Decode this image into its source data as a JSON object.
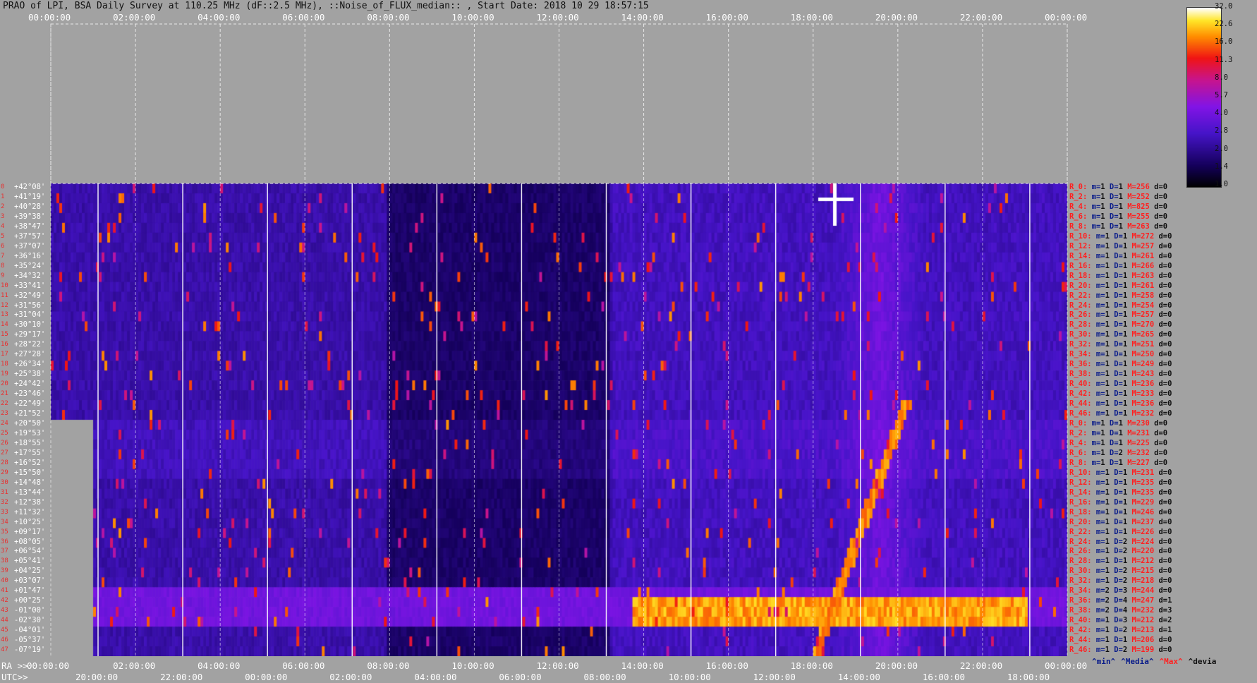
{
  "title": "PRAO of LPI, BSA Daily Survey at 110.25 MHz (dF::2.5 MHz), ::Noise_of_FLUX_median:: , Start Date: 2018 10 29 18:57:15",
  "top_axis": [
    "00:00:00",
    "02:00:00",
    "04:00:00",
    "06:00:00",
    "08:00:00",
    "10:00:00",
    "12:00:00",
    "14:00:00",
    "16:00:00",
    "18:00:00",
    "20:00:00",
    "22:00:00",
    "00:00:00"
  ],
  "ra_axis": {
    "prefix": "RA >>",
    "labels": [
      "00:00:00",
      "02:00:00",
      "04:00:00",
      "06:00:00",
      "08:00:00",
      "10:00:00",
      "12:00:00",
      "14:00:00",
      "16:00:00",
      "18:00:00",
      "20:00:00",
      "22:00:00",
      "00:00:00"
    ]
  },
  "utc_axis": {
    "prefix": "UTC>>",
    "labels": [
      "20:00:00",
      "22:00:00",
      "00:00:00",
      "02:00:00",
      "04:00:00",
      "06:00:00",
      "08:00:00",
      "10:00:00",
      "12:00:00",
      "14:00:00",
      "16:00:00",
      "18:00:00"
    ]
  },
  "colorbar": {
    "labels": [
      "32.0",
      "22.6",
      "16.0",
      "11.3",
      "8.0",
      "5.7",
      "4.0",
      "2.8",
      "2.0",
      "1.4",
      "1.0"
    ]
  },
  "declinations": [
    "+42°08'",
    "+41°19'",
    "+40°28'",
    "+39°38'",
    "+38°47'",
    "+37°57'",
    "+37°07'",
    "+36°16'",
    "+35°24'",
    "+34°32'",
    "+33°41'",
    "+32°49'",
    "+31°56'",
    "+31°04'",
    "+30°10'",
    "+29°17'",
    "+28°22'",
    "+27°28'",
    "+26°34'",
    "+25°38'",
    "+24°42'",
    "+23°46'",
    "+22°49'",
    "+21°52'",
    "+20°50'",
    "+19°53'",
    "+18°55'",
    "+17°55'",
    "+16°52'",
    "+15°50'",
    "+14°48'",
    "+13°44'",
    "+12°38'",
    "+11°32'",
    "+10°25'",
    "+09°17'",
    "+08°05'",
    "+06°54'",
    "+05°41'",
    "+04°25'",
    "+03°07'",
    "+01°47'",
    "+00°25'",
    "-01°00'",
    "-02°30'",
    "-04°01'",
    "-05°37'",
    "-07°19'"
  ],
  "row_numbers": [
    "0",
    "1",
    "2",
    "3",
    "4",
    "5",
    "6",
    "7",
    "8",
    "9",
    "10",
    "11",
    "12",
    "13",
    "14",
    "15",
    "16",
    "17",
    "18",
    "19",
    "20",
    "21",
    "22",
    "23",
    "24",
    "25",
    "26",
    "27",
    "28",
    "29",
    "30",
    "31",
    "32",
    "33",
    "34",
    "35",
    "36",
    "37",
    "38",
    "39",
    "40",
    "41",
    "42",
    "43",
    "44",
    "45",
    "46",
    "47"
  ],
  "stats": [
    {
      "r": "R_0:",
      "m": "1",
      "d": "1",
      "M": "256",
      "dv": "0"
    },
    {
      "r": "R_2:",
      "m": "1",
      "d": "1",
      "M": "252",
      "dv": "0"
    },
    {
      "r": "R_4:",
      "m": "1",
      "d": "1",
      "M": "825",
      "dv": "0"
    },
    {
      "r": "R_6:",
      "m": "1",
      "d": "1",
      "M": "255",
      "dv": "0"
    },
    {
      "r": "R_8:",
      "m": "1",
      "d": "1",
      "M": "263",
      "dv": "0"
    },
    {
      "r": "R_10:",
      "m": "1",
      "d": "1",
      "M": "272",
      "dv": "0"
    },
    {
      "r": "R_12:",
      "m": "1",
      "d": "1",
      "M": "257",
      "dv": "0"
    },
    {
      "r": "R_14:",
      "m": "1",
      "d": "1",
      "M": "261",
      "dv": "0"
    },
    {
      "r": "R_16:",
      "m": "1",
      "d": "1",
      "M": "266",
      "dv": "0"
    },
    {
      "r": "R_18:",
      "m": "1",
      "d": "1",
      "M": "263",
      "dv": "0"
    },
    {
      "r": "R_20:",
      "m": "1",
      "d": "1",
      "M": "261",
      "dv": "0"
    },
    {
      "r": "R_22:",
      "m": "1",
      "d": "1",
      "M": "258",
      "dv": "0"
    },
    {
      "r": "R_24:",
      "m": "1",
      "d": "1",
      "M": "254",
      "dv": "0"
    },
    {
      "r": "R_26:",
      "m": "1",
      "d": "1",
      "M": "257",
      "dv": "0"
    },
    {
      "r": "R_28:",
      "m": "1",
      "d": "1",
      "M": "270",
      "dv": "0"
    },
    {
      "r": "R_30:",
      "m": "1",
      "d": "1",
      "M": "265",
      "dv": "0"
    },
    {
      "r": "R_32:",
      "m": "1",
      "d": "1",
      "M": "251",
      "dv": "0"
    },
    {
      "r": "R_34:",
      "m": "1",
      "d": "1",
      "M": "250",
      "dv": "0"
    },
    {
      "r": "R_36:",
      "m": "1",
      "d": "1",
      "M": "249",
      "dv": "0"
    },
    {
      "r": "R_38:",
      "m": "1",
      "d": "1",
      "M": "243",
      "dv": "0"
    },
    {
      "r": "R_40:",
      "m": "1",
      "d": "1",
      "M": "236",
      "dv": "0"
    },
    {
      "r": "R_42:",
      "m": "1",
      "d": "1",
      "M": "233",
      "dv": "0"
    },
    {
      "r": "R_44:",
      "m": "1",
      "d": "1",
      "M": "236",
      "dv": "0"
    },
    {
      "r": "R_46:",
      "m": "1",
      "d": "1",
      "M": "232",
      "dv": "0"
    },
    {
      "r": "R_0:",
      "m": "1",
      "d": "1",
      "M": "230",
      "dv": "0"
    },
    {
      "r": "R_2:",
      "m": "1",
      "d": "1",
      "M": "231",
      "dv": "0"
    },
    {
      "r": "R_4:",
      "m": "1",
      "d": "1",
      "M": "225",
      "dv": "0"
    },
    {
      "r": "R_6:",
      "m": "1",
      "d": "2",
      "M": "232",
      "dv": "0"
    },
    {
      "r": "R_8:",
      "m": "1",
      "d": "1",
      "M": "227",
      "dv": "0"
    },
    {
      "r": "R_10:",
      "m": "1",
      "d": "1",
      "M": "231",
      "dv": "0"
    },
    {
      "r": "R_12:",
      "m": "1",
      "d": "1",
      "M": "235",
      "dv": "0"
    },
    {
      "r": "R_14:",
      "m": "1",
      "d": "1",
      "M": "235",
      "dv": "0"
    },
    {
      "r": "R_16:",
      "m": "1",
      "d": "1",
      "M": "229",
      "dv": "0"
    },
    {
      "r": "R_18:",
      "m": "1",
      "d": "1",
      "M": "246",
      "dv": "0"
    },
    {
      "r": "R_20:",
      "m": "1",
      "d": "1",
      "M": "237",
      "dv": "0"
    },
    {
      "r": "R_22:",
      "m": "1",
      "d": "1",
      "M": "226",
      "dv": "0"
    },
    {
      "r": "R_24:",
      "m": "1",
      "d": "2",
      "M": "224",
      "dv": "0"
    },
    {
      "r": "R_26:",
      "m": "1",
      "d": "2",
      "M": "220",
      "dv": "0"
    },
    {
      "r": "R_28:",
      "m": "1",
      "d": "1",
      "M": "212",
      "dv": "0"
    },
    {
      "r": "R_30:",
      "m": "1",
      "d": "2",
      "M": "215",
      "dv": "0"
    },
    {
      "r": "R_32:",
      "m": "1",
      "d": "2",
      "M": "218",
      "dv": "0"
    },
    {
      "r": "R_34:",
      "m": "2",
      "d": "3",
      "M": "244",
      "dv": "0"
    },
    {
      "r": "R_36:",
      "m": "2",
      "d": "4",
      "M": "247",
      "dv": "1"
    },
    {
      "r": "R_38:",
      "m": "2",
      "d": "4",
      "M": "232",
      "dv": "3"
    },
    {
      "r": "R_40:",
      "m": "1",
      "d": "3",
      "M": "212",
      "dv": "2"
    },
    {
      "r": "R_42:",
      "m": "1",
      "d": "2",
      "M": "213",
      "dv": "1"
    },
    {
      "r": "R_44:",
      "m": "1",
      "d": "1",
      "M": "206",
      "dv": "0"
    },
    {
      "r": "R_46:",
      "m": "1",
      "d": "2",
      "M": "199",
      "dv": "0"
    }
  ],
  "stat_keys": {
    "m": "m=",
    "d": "D=",
    "M": "M=",
    "dv": "d="
  },
  "legend": {
    "min": "^min^",
    "median": "^Media^",
    "max": "^Max^",
    "devia": "^devia"
  }
}
